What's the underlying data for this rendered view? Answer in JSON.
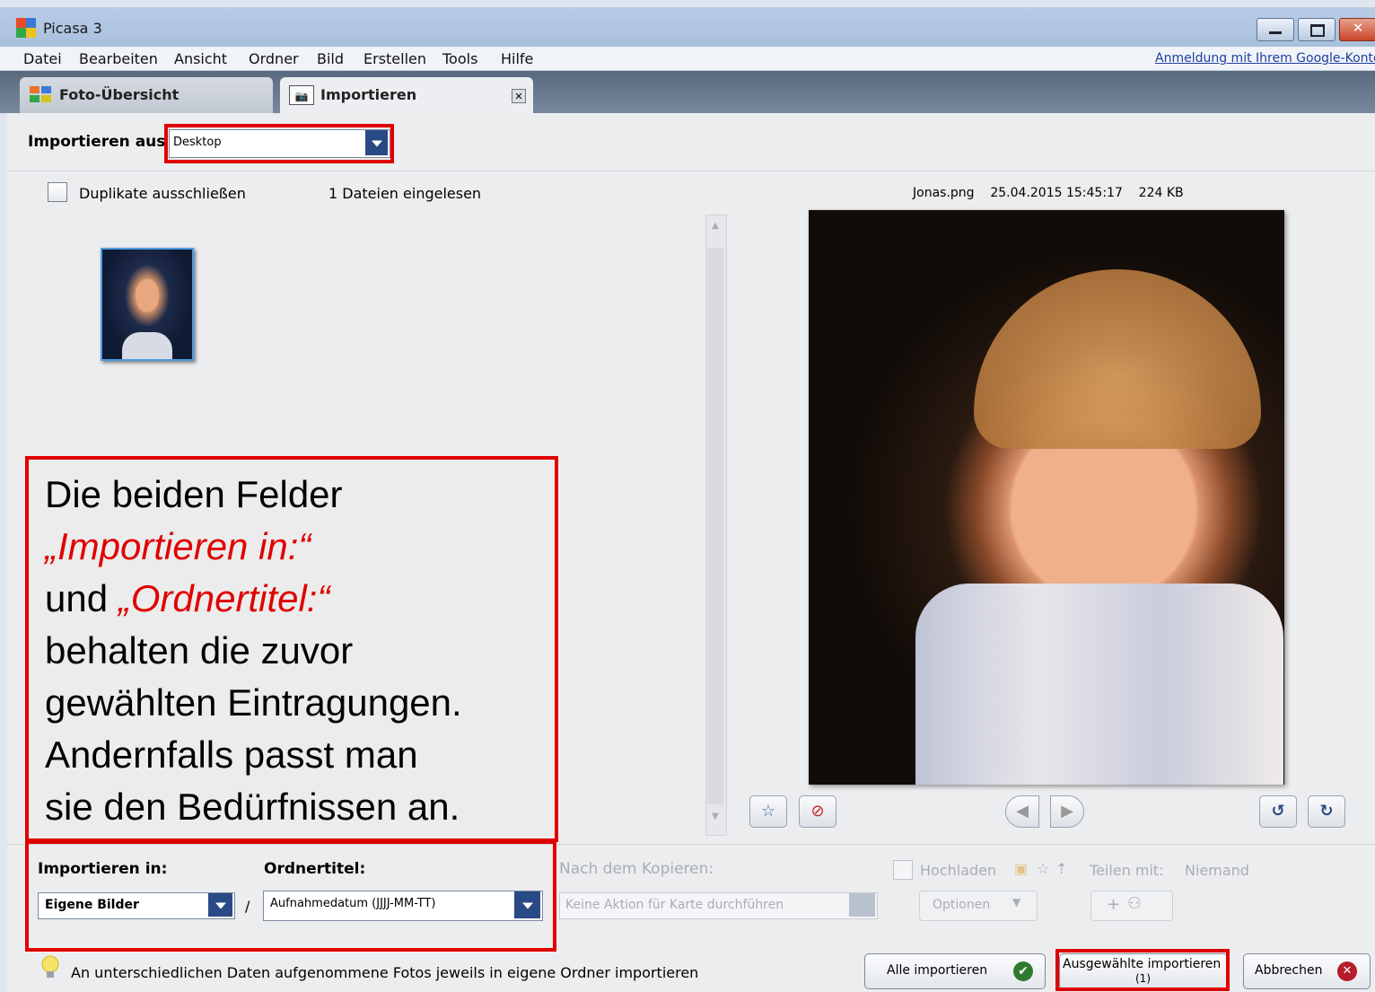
{
  "window": {
    "title": "Picasa 3"
  },
  "menu": {
    "items": [
      "Datei",
      "Bearbeiten",
      "Ansicht",
      "Ordner",
      "Bild",
      "Erstellen",
      "Tools",
      "Hilfe"
    ],
    "login_link": "Anmeldung mit Ihrem Google-Konto"
  },
  "tabs": [
    {
      "label": "Foto-Übersicht"
    },
    {
      "label": "Importieren"
    }
  ],
  "import_from": {
    "label": "Importieren aus",
    "value": "Desktop"
  },
  "options": {
    "exclude_duplicates_label": "Duplikate ausschließen",
    "exclude_duplicates_checked": false,
    "files_read": "1 Dateien eingelesen"
  },
  "preview": {
    "filename": "Jonas.png",
    "date": "25.04.2015 15:45:17",
    "size": "224 KB"
  },
  "annotation": {
    "line1": "Die beiden Felder",
    "field1": "„Importieren in:“",
    "line3_prefix": "und ",
    "field2": "„Ordnertitel:“",
    "line4": "behalten die zuvor",
    "line5": "gewählten Eintragungen.",
    "line6": "Andernfalls passt man",
    "line7": "sie den Bedürfnissen an."
  },
  "import_to": {
    "label": "Importieren in:",
    "value": "Eigene Bilder",
    "separator": "/"
  },
  "folder_title": {
    "label": "Ordnertitel:",
    "value": "Aufnahmedatum (JJJJ-MM-TT)"
  },
  "after_copy": {
    "label": "Nach dem Kopieren:",
    "value": "Keine Aktion für Karte durchführen"
  },
  "upload": {
    "label": "Hochladen",
    "share_label": "Teilen mit:",
    "share_value": "Niemand",
    "options_label": "Optionen",
    "add_people": "+"
  },
  "footer": {
    "tip": "An unterschiedlichen Daten aufgenommene Fotos jeweils in eigene Ordner importieren",
    "import_all": "Alle importieren",
    "import_selected": "Ausgewählte importieren",
    "import_selected_count": "(1)",
    "cancel": "Abbrechen"
  },
  "colors": {
    "highlight": "#e00000",
    "accent": "#2a4a86"
  }
}
